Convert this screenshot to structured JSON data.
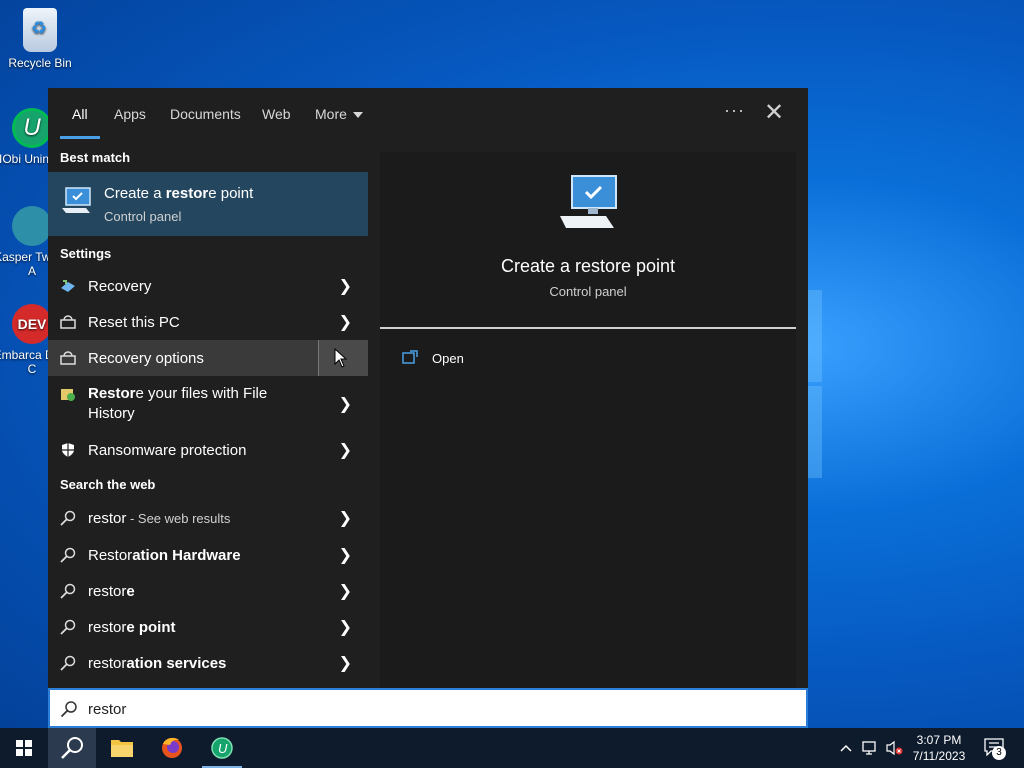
{
  "desktop": {
    "icons": [
      {
        "label": "Recycle Bin"
      },
      {
        "label": "IObi Uninsta"
      },
      {
        "label": "Kasper Tweak A"
      },
      {
        "label": "Embarca Dev-C"
      }
    ]
  },
  "search": {
    "tabs": [
      {
        "label": "All",
        "active": true
      },
      {
        "label": "Apps"
      },
      {
        "label": "Documents"
      },
      {
        "label": "Web"
      },
      {
        "label": "More"
      }
    ],
    "more_label": "More",
    "dots_label": "···",
    "close_label": "✕",
    "best_match_header": "Best match",
    "best_match": {
      "title_pre": "Create a ",
      "title_bold": "restor",
      "title_post": "e point",
      "subtitle": "Control panel"
    },
    "settings_header": "Settings",
    "settings_items": [
      {
        "label": "Recovery"
      },
      {
        "label": "Reset this PC"
      },
      {
        "label": "Recovery options"
      },
      {
        "label_bold": "Restor",
        "label_rest": "e your files with File History"
      },
      {
        "label": "Ransomware protection"
      }
    ],
    "web_header": "Search the web",
    "web_items": [
      {
        "main": "restor",
        "suffix": " - See web results"
      },
      {
        "plain": "Restor",
        "bold": "ation Hardware"
      },
      {
        "plain": "restor",
        "bold": "e"
      },
      {
        "plain": "restor",
        "bold": "e point"
      },
      {
        "plain": "restor",
        "bold": "ation services"
      }
    ],
    "preview": {
      "title": "Create a restore point",
      "subtitle": "Control panel",
      "open_label": "Open"
    },
    "query": "restor"
  },
  "taskbar": {
    "time": "3:07 PM",
    "date": "7/11/2023",
    "notification_count": "3"
  },
  "colors": {
    "accent": "#4aa0e6",
    "panel_bg": "#1f1f1f",
    "best_match_bg": "#24475f",
    "taskbar_bg": "#0e1b2c"
  }
}
